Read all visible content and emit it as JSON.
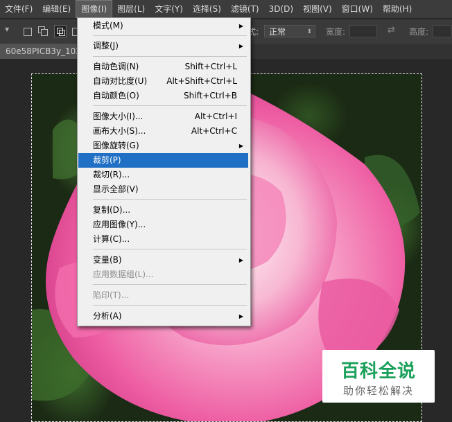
{
  "menubar": {
    "items": [
      "文件(F)",
      "编辑(E)",
      "图像(I)",
      "图层(L)",
      "文字(Y)",
      "选择(S)",
      "滤镜(T)",
      "3D(D)",
      "视图(V)",
      "窗口(W)",
      "帮助(H)"
    ],
    "active": "图像(I)"
  },
  "options_bar": {
    "style_suffix": "式:",
    "style_value": "正常",
    "width_label": "宽度:",
    "height_label": "高度:"
  },
  "document": {
    "tab_title": "60e58PICB3y_1024"
  },
  "image_menu": {
    "items": [
      {
        "label": "模式(M)",
        "shortcut": "",
        "submenu": true,
        "highlighted": false,
        "disabled": false
      },
      {
        "label": "调整(J)",
        "shortcut": "",
        "submenu": true,
        "highlighted": false,
        "disabled": false
      },
      {
        "label": "自动色调(N)",
        "shortcut": "Shift+Ctrl+L",
        "submenu": false,
        "highlighted": false,
        "disabled": false
      },
      {
        "label": "自动对比度(U)",
        "shortcut": "Alt+Shift+Ctrl+L",
        "submenu": false,
        "highlighted": false,
        "disabled": false
      },
      {
        "label": "自动颜色(O)",
        "shortcut": "Shift+Ctrl+B",
        "submenu": false,
        "highlighted": false,
        "disabled": false
      },
      {
        "label": "图像大小(I)...",
        "shortcut": "Alt+Ctrl+I",
        "submenu": false,
        "highlighted": false,
        "disabled": false
      },
      {
        "label": "画布大小(S)...",
        "shortcut": "Alt+Ctrl+C",
        "submenu": false,
        "highlighted": false,
        "disabled": false
      },
      {
        "label": "图像旋转(G)",
        "shortcut": "",
        "submenu": true,
        "highlighted": false,
        "disabled": false
      },
      {
        "label": "裁剪(P)",
        "shortcut": "",
        "submenu": false,
        "highlighted": true,
        "disabled": false
      },
      {
        "label": "裁切(R)...",
        "shortcut": "",
        "submenu": false,
        "highlighted": false,
        "disabled": false
      },
      {
        "label": "显示全部(V)",
        "shortcut": "",
        "submenu": false,
        "highlighted": false,
        "disabled": false
      },
      {
        "label": "复制(D)...",
        "shortcut": "",
        "submenu": false,
        "highlighted": false,
        "disabled": false
      },
      {
        "label": "应用图像(Y)...",
        "shortcut": "",
        "submenu": false,
        "highlighted": false,
        "disabled": false
      },
      {
        "label": "计算(C)...",
        "shortcut": "",
        "submenu": false,
        "highlighted": false,
        "disabled": false
      },
      {
        "label": "变量(B)",
        "shortcut": "",
        "submenu": true,
        "highlighted": false,
        "disabled": false
      },
      {
        "label": "应用数据组(L)...",
        "shortcut": "",
        "submenu": false,
        "highlighted": false,
        "disabled": true
      },
      {
        "label": "陷印(T)...",
        "shortcut": "",
        "submenu": false,
        "highlighted": false,
        "disabled": true
      },
      {
        "label": "分析(A)",
        "shortcut": "",
        "submenu": true,
        "highlighted": false,
        "disabled": false
      }
    ]
  },
  "watermark": {
    "title": "百科全说",
    "subtitle": "助你轻松解决"
  },
  "colors": {
    "menu_highlight": "#1f6fc4",
    "watermark_green": "#1aa05a",
    "rose_pink": "#f06aa8"
  }
}
